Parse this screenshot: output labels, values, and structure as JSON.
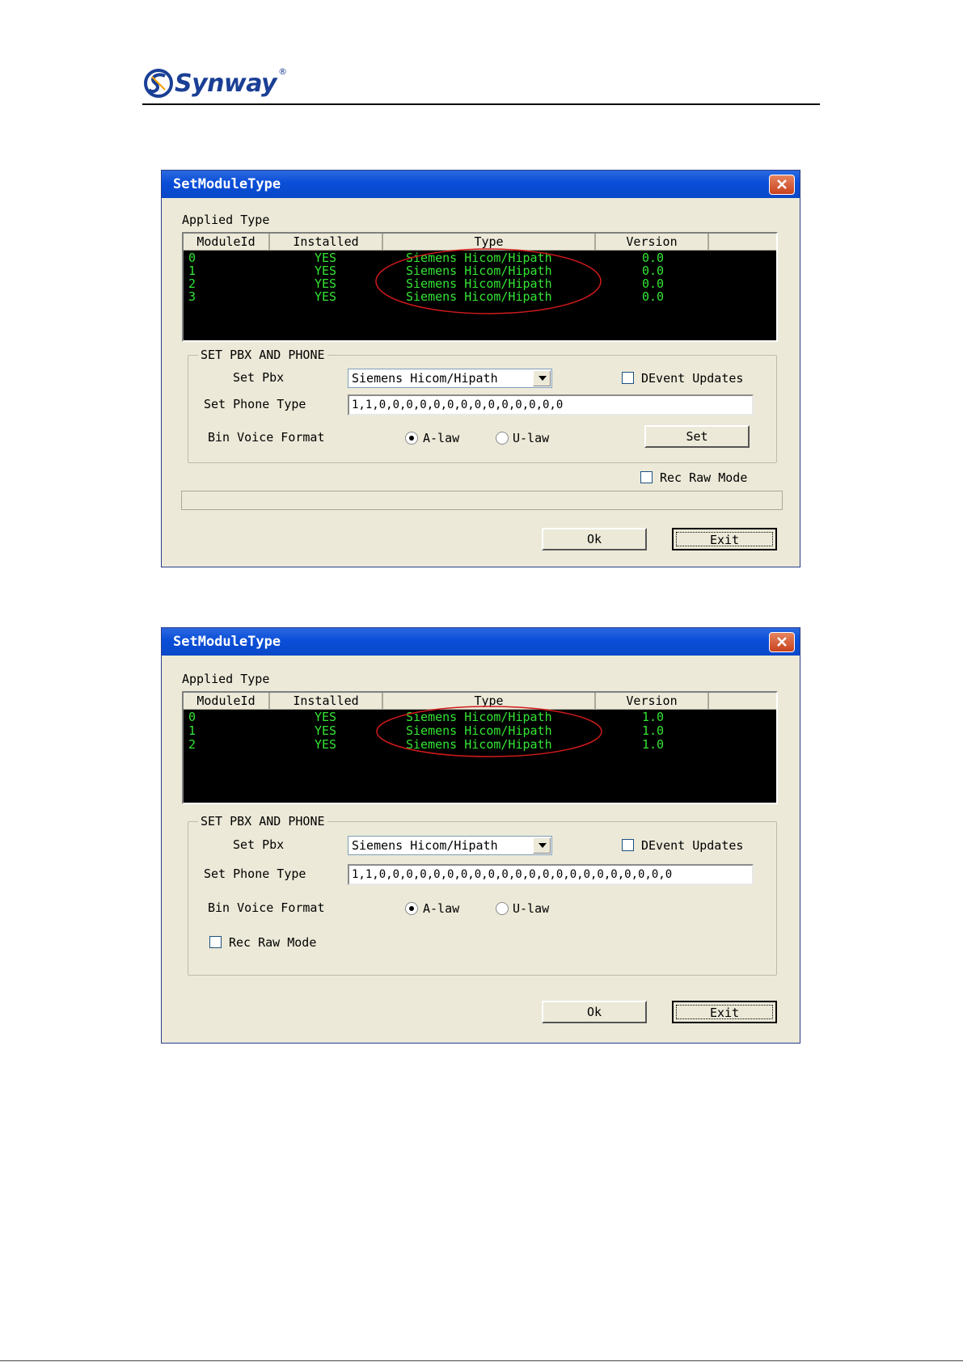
{
  "logo": {
    "text": "Synway",
    "reg": "®",
    "color": "#1a3f95"
  },
  "dialogs": [
    {
      "title": "SetModuleType",
      "applied_type_label": "Applied Type",
      "columns": [
        "ModuleId",
        "Installed",
        "Type",
        "Version"
      ],
      "rows": [
        [
          "0",
          "YES",
          "Siemens Hicom/Hipath",
          "0.0"
        ],
        [
          "1",
          "YES",
          "Siemens Hicom/Hipath",
          "0.0"
        ],
        [
          "2",
          "YES",
          "Siemens Hicom/Hipath",
          "0.0"
        ],
        [
          "3",
          "YES",
          "Siemens Hicom/Hipath",
          "0.0"
        ]
      ],
      "group_label": "SET PBX AND PHONE",
      "set_pbx_label": "Set Pbx",
      "set_pbx_value": "Siemens Hicom/Hipath",
      "devent_label": "DEvent Updates",
      "phone_type_label": "Set Phone Type",
      "phone_type_value": "1,1,0,0,0,0,0,0,0,0,0,0,0,0,0,0",
      "voice_label": "Bin Voice Format",
      "alaw_label": "A-law",
      "ulaw_label": "U-law",
      "set_button": "Set",
      "rec_raw_label": "Rec Raw Mode",
      "ok_button": "Ok",
      "exit_button": "Exit"
    },
    {
      "title": "SetModuleType",
      "applied_type_label": "Applied Type",
      "columns": [
        "ModuleId",
        "Installed",
        "Type",
        "Version"
      ],
      "rows": [
        [
          "0",
          "YES",
          "Siemens Hicom/Hipath",
          "1.0"
        ],
        [
          "1",
          "YES",
          "Siemens Hicom/Hipath",
          "1.0"
        ],
        [
          "2",
          "YES",
          "Siemens Hicom/Hipath",
          "1.0"
        ]
      ],
      "group_label": "SET PBX AND PHONE",
      "set_pbx_label": "Set Pbx",
      "set_pbx_value": "Siemens Hicom/Hipath",
      "devent_label": "DEvent Updates",
      "phone_type_label": "Set Phone Type",
      "phone_type_value": "1,1,0,0,0,0,0,0,0,0,0,0,0,0,0,0,0,0,0,0,0,0,0,0",
      "voice_label": "Bin Voice Format",
      "alaw_label": "A-law",
      "ulaw_label": "U-law",
      "rec_raw_label": "Rec Raw Mode",
      "ok_button": "Ok",
      "exit_button": "Exit"
    }
  ]
}
